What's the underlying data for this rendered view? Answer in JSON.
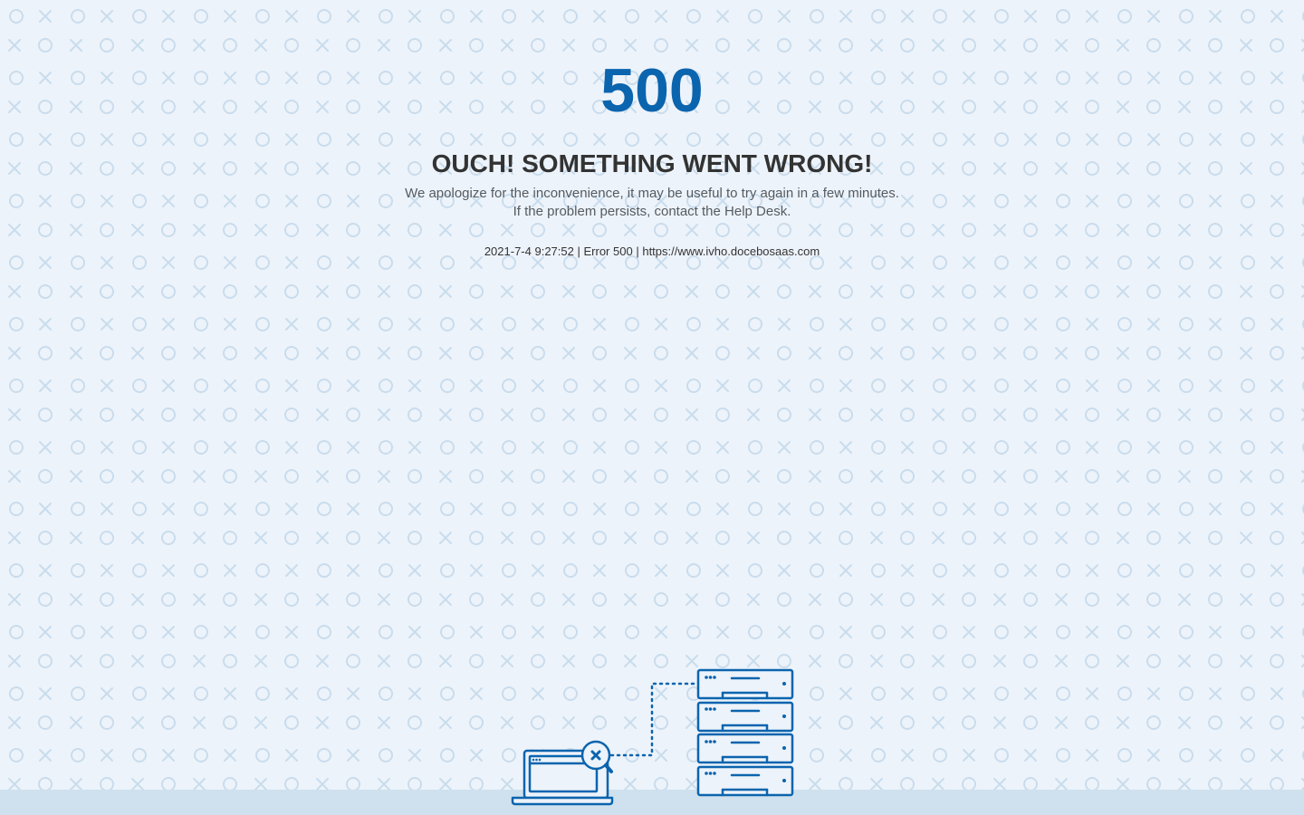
{
  "error": {
    "code": "500",
    "headline": "OUCH! SOMETHING WENT WRONG!",
    "message_line1": "We apologize for the inconvenience, it may be useful to try again in a few minutes.",
    "message_line2": "If the problem persists, contact the Help Desk.",
    "meta": {
      "timestamp": "2021-7-4 9:27:52",
      "separator": "|",
      "error_label": "Error 500",
      "url": "https://www.ivho.docebosaas.com"
    }
  },
  "colors": {
    "accent": "#0b64ae",
    "background": "#edf3fa",
    "pattern": "#c9dced",
    "footer": "#cfe1ee",
    "text_dark": "#333333",
    "text_muted": "#555b60"
  },
  "illustration": {
    "icons": [
      "laptop-icon",
      "magnifier-error-icon",
      "server-rack-icon"
    ]
  }
}
